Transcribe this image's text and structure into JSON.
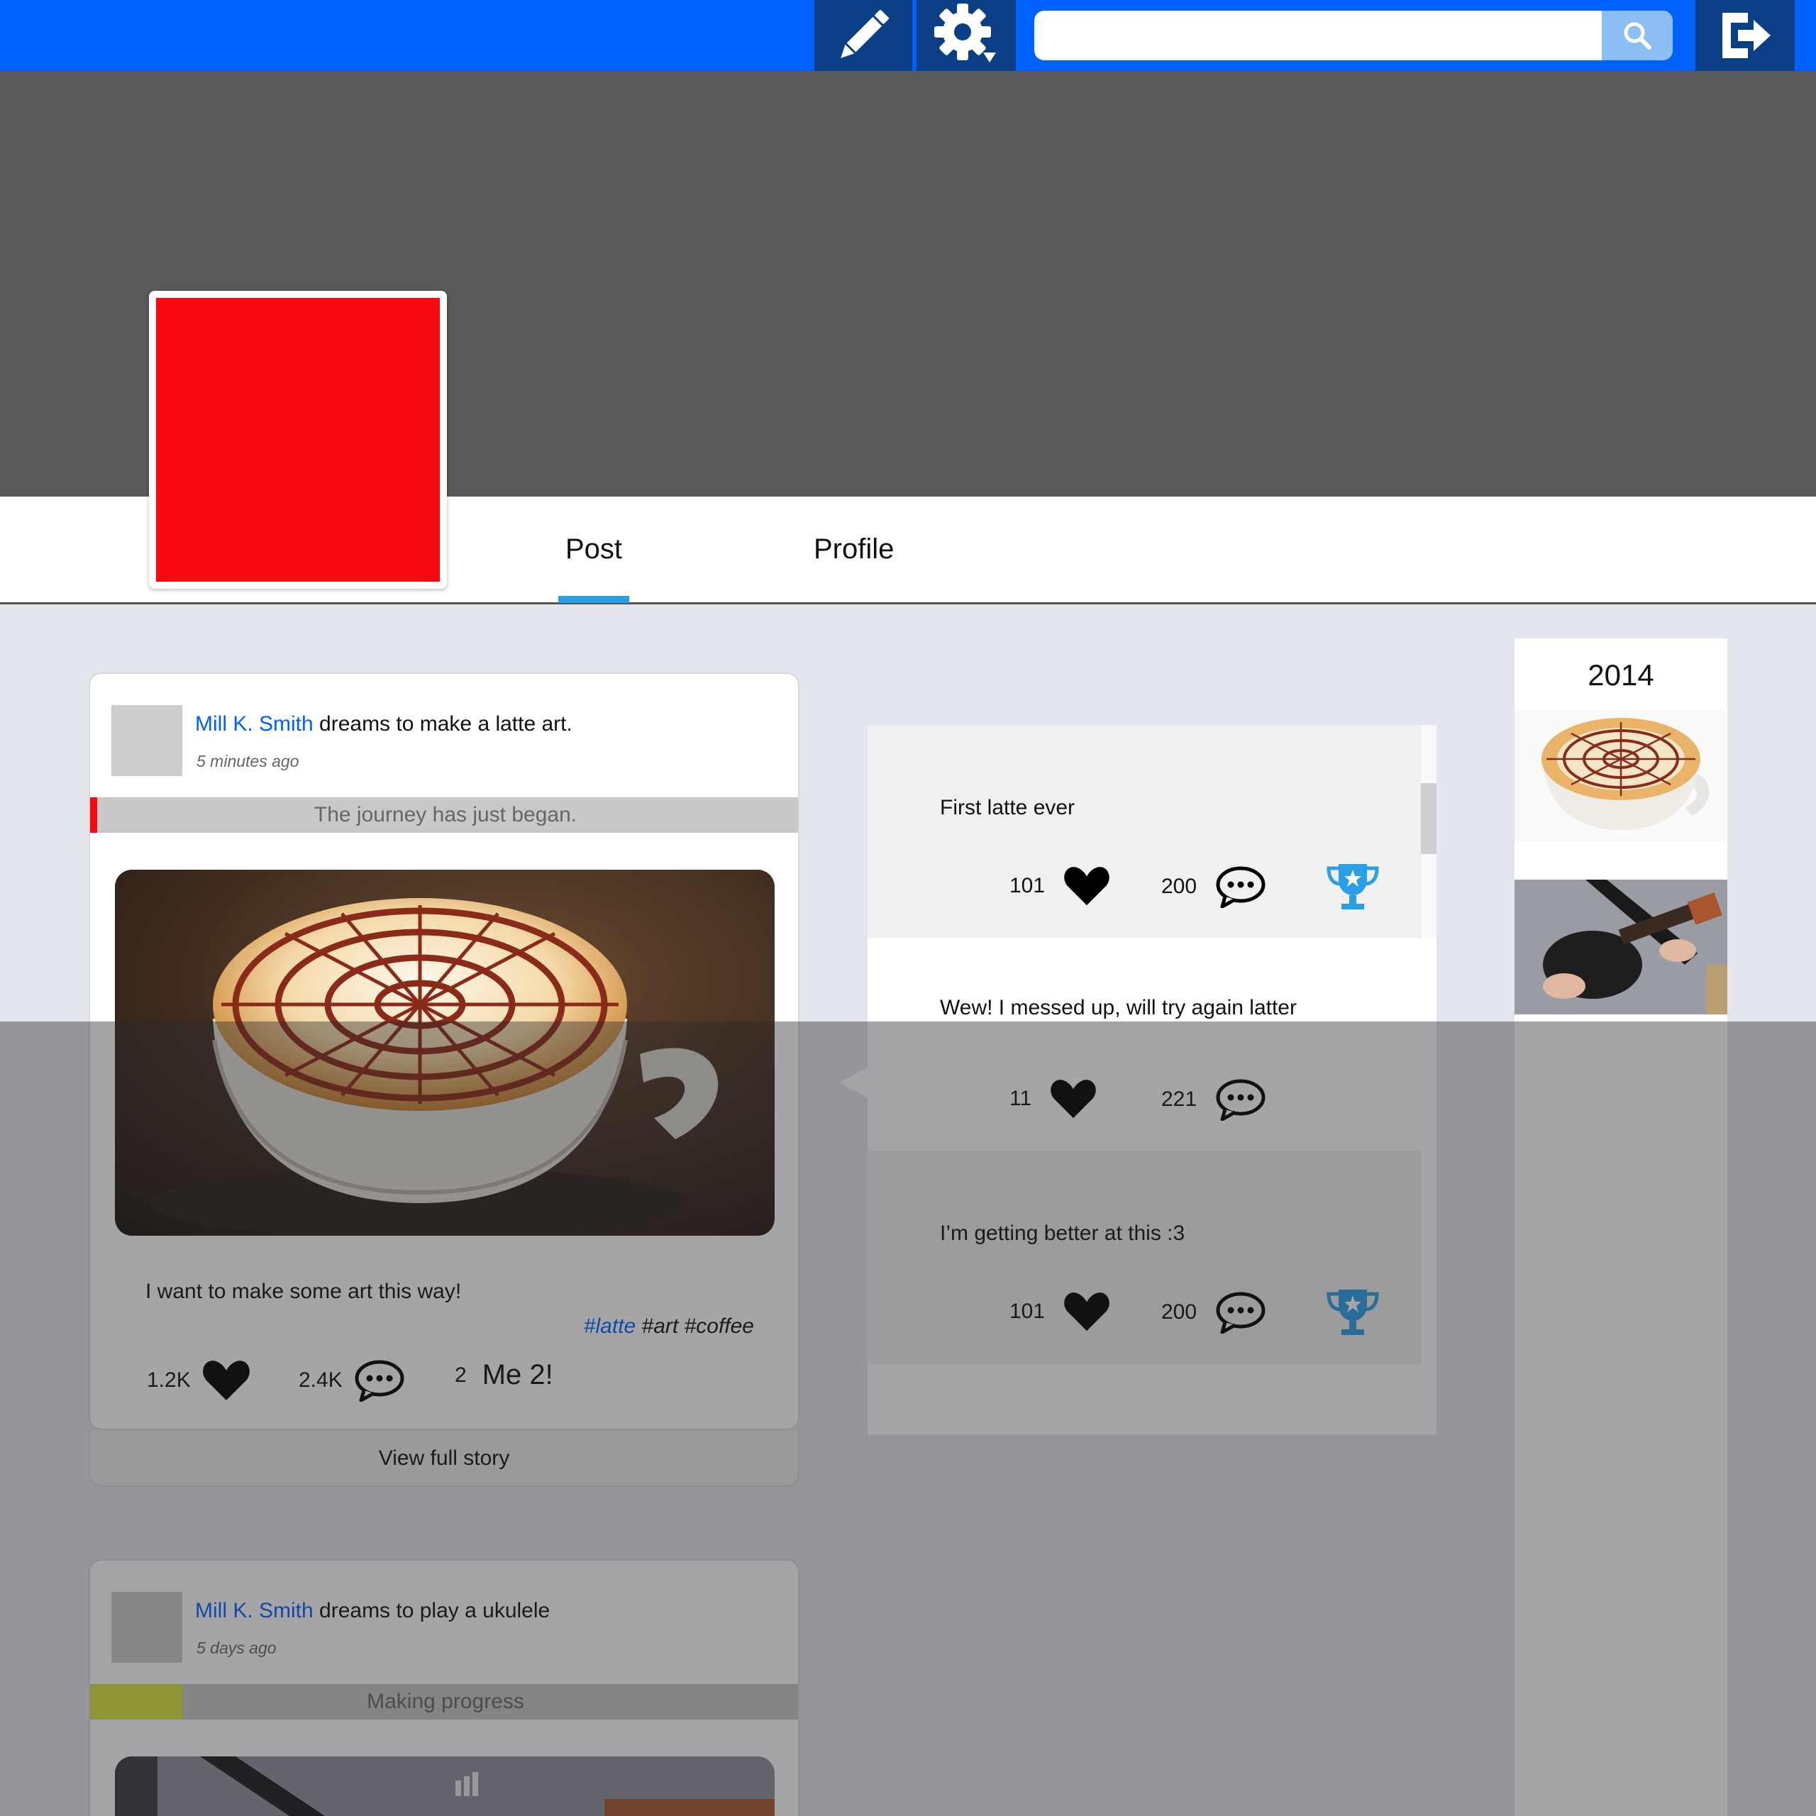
{
  "search": {
    "value": "",
    "placeholder": ""
  },
  "tabs": {
    "post": "Post",
    "profile": "Profile"
  },
  "colors": {
    "topbar": "#0062fe",
    "accent": "#2b9fe6",
    "avatar": "#f70b10",
    "cover": "#595959",
    "link": "#0062fe",
    "trophy": "#2b9fe6"
  },
  "icons": {
    "edit": "pencil-icon",
    "settings": "gear-icon",
    "search": "search-icon",
    "logout": "logout-icon",
    "like": "heart-icon",
    "comment": "comment-icon",
    "award": "trophy-icon"
  },
  "posts": [
    {
      "author": "Mill K. Smith",
      "text": " dreams to make a latte art.",
      "time": "5 minutes ago",
      "banner": "The journey has just began.",
      "caption": "I want to make some art this way!",
      "tags": [
        "#latte",
        " #art #coffee"
      ],
      "likes": "1.2K",
      "comments": "2.4K",
      "me2_count": "2",
      "me2_label": "Me 2!",
      "view_full": "View full story"
    },
    {
      "author": "Mill K. Smith",
      "text": " dreams to play a ukulele",
      "time": "5 days ago",
      "banner": "Making progress"
    }
  ],
  "timeline": [
    {
      "title": "First latte ever",
      "likes": "101",
      "comments": "200",
      "award": true
    },
    {
      "title": "Wew! I messed up, will try again latter",
      "likes": "11",
      "comments": "221",
      "award": false
    },
    {
      "title": "I’m getting better at this :3",
      "likes": "101",
      "comments": "200",
      "award": true
    }
  ],
  "sidebar": {
    "year": "2014"
  }
}
